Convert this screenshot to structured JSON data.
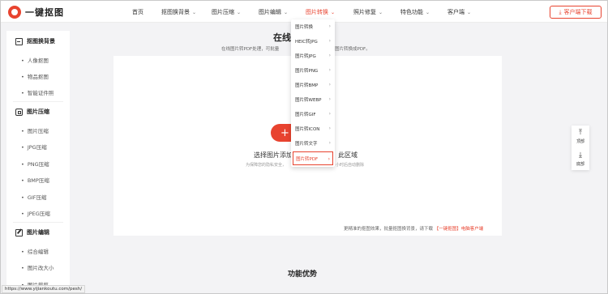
{
  "header": {
    "logo_text": "一键抠图",
    "nav": [
      {
        "label": "首页",
        "chev": ""
      },
      {
        "label": "抠图换背景",
        "chev": "⌄"
      },
      {
        "label": "图片压缩",
        "chev": "⌄"
      },
      {
        "label": "图片编辑",
        "chev": "⌄"
      },
      {
        "label": "图片转换",
        "chev": "⌄"
      },
      {
        "label": "照片修复",
        "chev": "⌄"
      },
      {
        "label": "特色功能",
        "chev": "⌄"
      },
      {
        "label": "客户端",
        "chev": "⌄"
      }
    ],
    "active_nav": "图片转换",
    "download_button": "客户端下载",
    "download_icon": "download-icon"
  },
  "sidebar": {
    "groups": [
      {
        "title": "抠图换背景",
        "icon": "image-icon",
        "items": [
          "人像抠图",
          "物品抠图",
          "智能证件照"
        ]
      },
      {
        "title": "图片压缩",
        "icon": "compress-icon",
        "items": [
          "图片压缩",
          "JPG压缩",
          "PNG压缩",
          "BMP压缩",
          "GIF压缩",
          "JPEG压缩"
        ]
      },
      {
        "title": "图片编辑",
        "icon": "edit-icon",
        "items": [
          "综合编辑",
          "图片改大小",
          "图片裁剪"
        ]
      }
    ]
  },
  "main": {
    "title": "在线图",
    "subtitle_left": "在线图片转PDF处理，可批量",
    "subtitle_right": "图片转换成PDF。",
    "add_symbol": "+",
    "upload_text_left": "选择图片添加",
    "upload_text_right": "此区域",
    "upload_note_left": "为保障您的隐私安全，",
    "upload_note_right": "小时后自动删除",
    "promo_text": "更精准的抠图效果，批量抠图换背景，请下载",
    "promo_link": "【一键抠图】电脑客户端",
    "features_title": "功能优势"
  },
  "dropdown": {
    "items": [
      "图片转换",
      "HEIC转JPG",
      "图片转JPG",
      "图片转PNG",
      "图片转BMP",
      "图片转WEBP",
      "图片转GIF",
      "图片转ICON",
      "图片转文字",
      "图片转PDF"
    ],
    "selected": "图片转PDF"
  },
  "float": {
    "top_label": "顶部",
    "bottom_label": "底部",
    "top_icon": "to-top-icon",
    "bottom_icon": "to-bottom-icon"
  },
  "statusbar": {
    "url": "https://www.yijiankoutu.com/pesh/"
  },
  "colors": {
    "accent": "#e8432f",
    "background": "#f3f3f5"
  }
}
